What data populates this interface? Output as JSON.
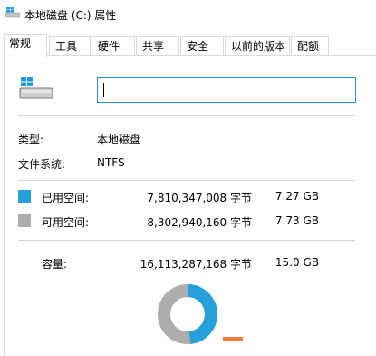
{
  "window": {
    "title": "本地磁盘 (C:) 属性"
  },
  "tabs": [
    {
      "label": "常规",
      "active": true
    },
    {
      "label": "工具"
    },
    {
      "label": "硬件"
    },
    {
      "label": "共享"
    },
    {
      "label": "安全"
    },
    {
      "label": "以前的版本"
    },
    {
      "label": "配额"
    }
  ],
  "general": {
    "name_value": "",
    "type_label": "类型:",
    "type_value": "本地磁盘",
    "fs_label": "文件系统:",
    "fs_value": "NTFS"
  },
  "space": {
    "used": {
      "label": "已用空间:",
      "bytes": "7,810,347,008 字节",
      "size": "7.27 GB",
      "color": "#26a0da"
    },
    "free": {
      "label": "可用空间:",
      "bytes": "8,302,940,160 字节",
      "size": "7.73 GB",
      "color": "#adadad"
    },
    "capacity": {
      "label": "容量:",
      "bytes": "16,113,287,168 字节",
      "size": "15.0 GB"
    },
    "used_fraction": 0.4847
  },
  "icons": {
    "title": "drive-icon",
    "drive": "drive-icon"
  }
}
